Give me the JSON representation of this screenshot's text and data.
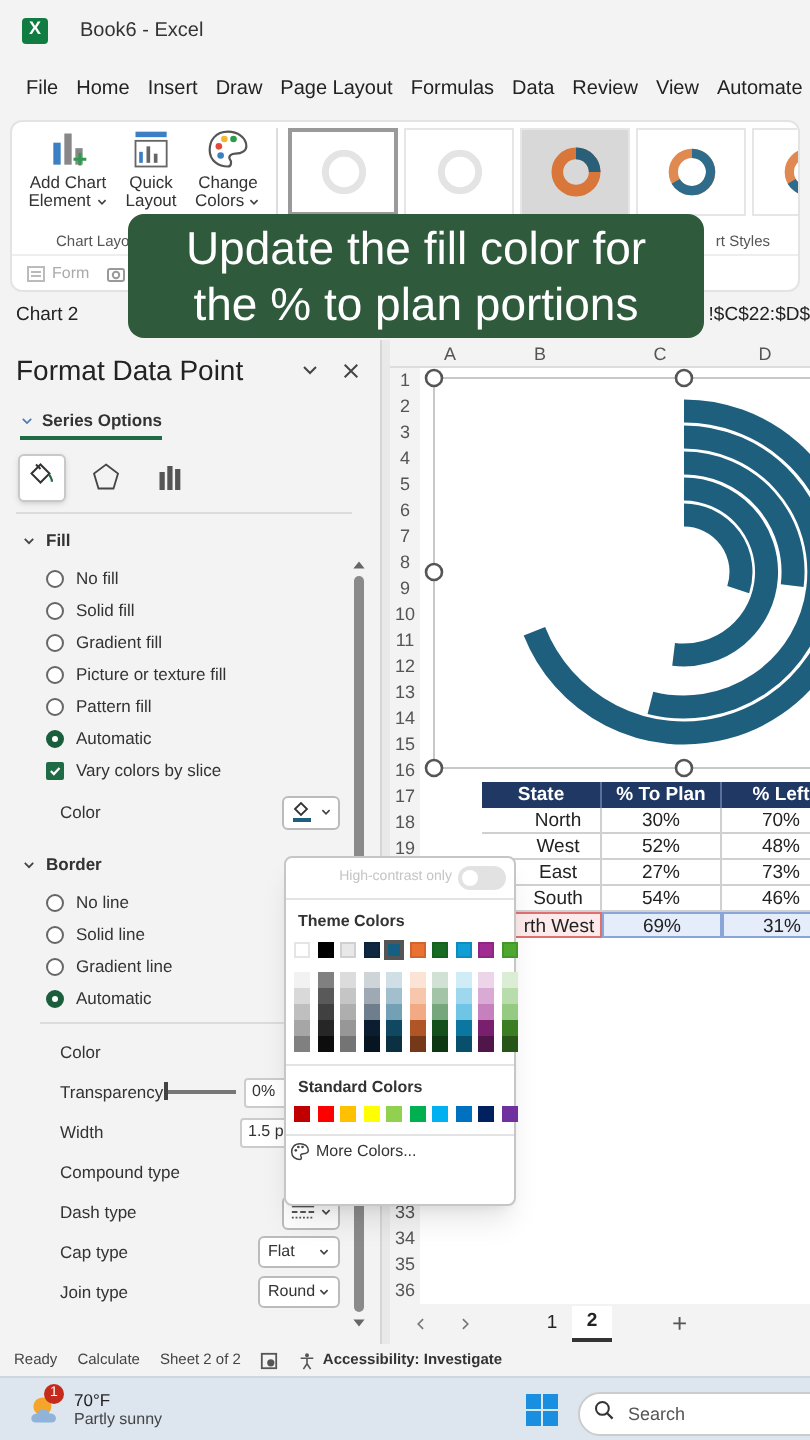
{
  "window": {
    "logo": "X",
    "title": "Book6 - Excel"
  },
  "menu": [
    "File",
    "Home",
    "Insert",
    "Draw",
    "Page Layout",
    "Formulas",
    "Data",
    "Review",
    "View",
    "Automate"
  ],
  "ribbon": {
    "buttons": [
      {
        "kind": "add_element",
        "label": "Add Chart Element"
      },
      {
        "kind": "quick_layout",
        "label": "Quick Layout"
      },
      {
        "kind": "change_colors",
        "label": "Change Colors"
      }
    ],
    "chart_styles": [
      {
        "kind": "plain",
        "selected": true
      },
      {
        "kind": "plain",
        "selected": false
      },
      {
        "kind": "dark",
        "selected": false
      },
      {
        "kind": "color",
        "selected": false
      },
      {
        "kind": "color",
        "selected": false
      }
    ],
    "group_labels": [
      "Chart Layo",
      "rt Styles"
    ],
    "form_button": {
      "label": "Form",
      "disabled": true
    }
  },
  "formula_bar": {
    "name_box": "Chart 2",
    "formula": "!$C$22:$D$"
  },
  "caption": "Update the fill color for the % to plan portions",
  "pane": {
    "title": "Format Data Point",
    "series_tab": {
      "label": "Series Options",
      "selected": true
    },
    "icon_tabs": [
      {
        "kind": "fill",
        "selected": true
      },
      {
        "kind": "effects",
        "selected": false
      },
      {
        "kind": "series",
        "selected": false
      }
    ],
    "fill": {
      "label": "Fill",
      "expanded": true,
      "options": [
        {
          "kind": "radio",
          "label": "No fill",
          "checked": false
        },
        {
          "kind": "radio",
          "label": "Solid fill",
          "checked": false
        },
        {
          "kind": "radio",
          "label": "Gradient fill",
          "checked": false
        },
        {
          "kind": "radio",
          "label": "Picture or texture fill",
          "checked": false
        },
        {
          "kind": "radio",
          "label": "Pattern fill",
          "checked": false
        },
        {
          "kind": "radio",
          "label": "Automatic",
          "checked": true
        },
        {
          "kind": "checkbox",
          "label": "Vary colors by slice",
          "checked": true
        }
      ],
      "color_label": "Color"
    },
    "border": {
      "label": "Border",
      "expanded": true,
      "options": [
        {
          "kind": "radio",
          "label": "No line",
          "checked": false
        },
        {
          "kind": "radio",
          "label": "Solid line",
          "checked": false
        },
        {
          "kind": "radio",
          "label": "Gradient line",
          "checked": false
        },
        {
          "kind": "radio",
          "label": "Automatic",
          "checked": true
        }
      ],
      "properties": [
        {
          "kind": "color",
          "label": "Color"
        },
        {
          "kind": "slider",
          "label": "Transparency",
          "level": 0,
          "value": "0%"
        },
        {
          "kind": "spin",
          "label": "Width",
          "value": "1.5 p"
        },
        {
          "kind": "plain",
          "label": "Compound type"
        },
        {
          "kind": "dash",
          "label": "Dash type"
        },
        {
          "kind": "dropdown",
          "label": "Cap type",
          "value": "Flat"
        },
        {
          "kind": "dropdown",
          "label": "Join type",
          "value": "Round"
        }
      ]
    }
  },
  "color_picker": {
    "high_contrast": {
      "label": "High-contrast only",
      "on": false,
      "disabled": true
    },
    "theme_title": "Theme Colors",
    "theme_colors": [
      {
        "color": "#ffffff",
        "selected": false
      },
      {
        "color": "#000000",
        "selected": false
      },
      {
        "color": "#e8e8e8",
        "selected": false
      },
      {
        "color": "#0e2841",
        "selected": false
      },
      {
        "color": "#156082",
        "selected": true
      },
      {
        "color": "#e97132",
        "selected": false
      },
      {
        "color": "#196b24",
        "selected": false
      },
      {
        "color": "#0f9ed5",
        "selected": false
      },
      {
        "color": "#a02b93",
        "selected": false
      },
      {
        "color": "#4ea72e",
        "selected": false
      }
    ],
    "standard_title": "Standard Colors",
    "standard_colors": [
      {
        "color": "#c00000"
      },
      {
        "color": "#ff0000"
      },
      {
        "color": "#ffc000"
      },
      {
        "color": "#ffff00"
      },
      {
        "color": "#92d050"
      },
      {
        "color": "#00b050"
      },
      {
        "color": "#00b0f0"
      },
      {
        "color": "#0070c0"
      },
      {
        "color": "#002060"
      },
      {
        "color": "#7030a0"
      }
    ],
    "more_colors": "More Colors..."
  },
  "sheet": {
    "columns": [
      "A",
      "B",
      "C",
      "D"
    ],
    "row_numbers": [
      "1",
      "2",
      "3",
      "4",
      "5",
      "6",
      "7",
      "8",
      "9",
      "10",
      "11",
      "12",
      "13",
      "14",
      "15",
      "16",
      "17",
      "18",
      "19",
      "33",
      "34",
      "35",
      "36"
    ],
    "table": {
      "columns": [
        "State",
        "% To Plan",
        "% Left"
      ],
      "rows": [
        {
          "cells": [
            "North",
            "30%",
            "70%"
          ],
          "selected": false
        },
        {
          "cells": [
            "West",
            "52%",
            "48%"
          ],
          "selected": false
        },
        {
          "cells": [
            "East",
            "27%",
            "73%"
          ],
          "selected": false
        },
        {
          "cells": [
            "South",
            "54%",
            "46%"
          ],
          "selected": false
        },
        {
          "cells": [
            "rth West",
            "69%",
            "31%"
          ],
          "selected": true
        }
      ]
    },
    "tabs": [
      {
        "label": "1",
        "selected": false
      },
      {
        "label": "2",
        "selected": true
      }
    ],
    "add_sheet": "+"
  },
  "status_bar": {
    "items": [
      "Ready",
      "Calculate",
      "Sheet 2 of 2"
    ],
    "accessibility": "Accessibility: Investigate"
  },
  "taskbar": {
    "weather": {
      "badge": "1",
      "temperature": "70°F",
      "condition": "Partly sunny"
    },
    "search": {
      "placeholder": "Search"
    }
  }
}
